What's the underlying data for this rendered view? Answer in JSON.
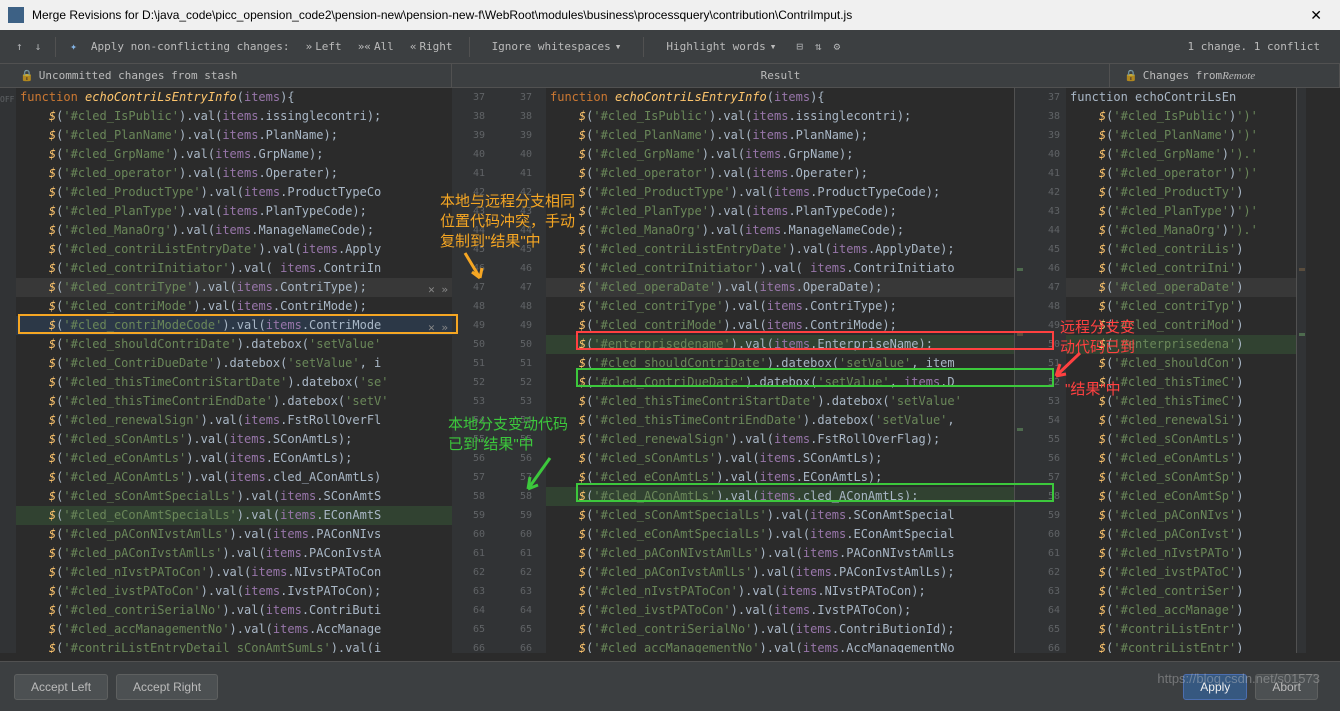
{
  "title": "Merge Revisions for D:\\java_code\\picc_opension_code2\\pension-new\\pension-new-f\\WebRoot\\modules\\business\\processquery\\contribution\\ContriImput.js",
  "toolbar": {
    "apply_label": "Apply non-conflicting changes:",
    "left_btn": "Left",
    "all_btn": "All",
    "right_btn": "Right",
    "ignore": "Ignore whitespaces",
    "highlight": "Highlight words",
    "status": "1 change. 1 conflict"
  },
  "headers": {
    "left": "Uncommitted changes from stash",
    "middle": "Result",
    "right_prefix": "Changes from ",
    "right_remote": "Remote"
  },
  "gutter_off": "OFF",
  "line_nums_left": [
    "37",
    "38",
    "39",
    "40",
    "41",
    "42",
    "43",
    "44",
    "45",
    "46",
    "47",
    "48",
    "49",
    "50",
    "51",
    "52",
    "53",
    "54",
    "55",
    "56",
    "57",
    "58",
    "",
    "59",
    "60",
    "61",
    "62",
    "63",
    "64",
    "65",
    "66"
  ],
  "line_nums_mid": [
    "37",
    "38",
    "39",
    "40",
    "41",
    "42",
    "43",
    "44",
    "45",
    "46",
    "47",
    "48",
    "49",
    "50",
    "51",
    "52",
    "53",
    "54",
    "55",
    "56",
    "57",
    "58",
    "59",
    "60",
    "61",
    "62",
    "63",
    "64",
    "65",
    "66"
  ],
  "left_code": [
    {
      "pre": "",
      "text": "function echoContriLsEntryInfo(items){",
      "cls": ""
    },
    {
      "pre": "    ",
      "sel": "#cled_IsPublic",
      "call": ".val(items.issinglecontri);"
    },
    {
      "pre": "    ",
      "sel": "#cled_PlanName",
      "call": ".val(items.PlanName);"
    },
    {
      "pre": "    ",
      "sel": "#cled_GrpName",
      "call": ".val(items.GrpName);"
    },
    {
      "pre": "    ",
      "sel": "#cled_operator",
      "call": ".val(items.Operater);"
    },
    {
      "pre": "    ",
      "sel": "#cled_ProductType",
      "call": ".val(items.ProductTypeCo"
    },
    {
      "pre": "    ",
      "sel": "#cled_PlanType",
      "call": ".val(items.PlanTypeCode);"
    },
    {
      "pre": "    ",
      "sel": "#cled_ManaOrg",
      "call": ".val(items.ManageNameCode);"
    },
    {
      "pre": "    ",
      "sel": "#cled_contriListEntryDate",
      "call": ".val(items.Apply"
    },
    {
      "pre": "    ",
      "sel": "#cled_contriInitiator",
      "call": ".val( items.ContriIn"
    },
    {
      "pre": "    ",
      "sel": "#cled_contriType",
      "call": ".val(items.ContriType);",
      "cls": "hl-gray",
      "marks": true
    },
    {
      "pre": "    ",
      "sel": "#cled_contriMode",
      "call": ".val(items.ContriMode);"
    },
    {
      "pre": "    ",
      "sel": "#cled_contriModeCode",
      "call": ".val(items.ContriMode",
      "cls": "hl-blue",
      "marks": true
    },
    {
      "pre": "    ",
      "sel": "#cled_shouldContriDate",
      "call": ".datebox('setValue'"
    },
    {
      "pre": "    ",
      "sel": "#cled_ContriDueDate",
      "call": ".datebox('setValue', i"
    },
    {
      "pre": "    ",
      "sel": "#cled_thisTimeContriStartDate",
      "call": ".datebox('se"
    },
    {
      "pre": "    ",
      "sel": "#cled_thisTimeContriEndDate",
      "call": ".datebox('setV"
    },
    {
      "pre": "    ",
      "sel": "#cled_renewalSign",
      "call": ".val(items.FstRollOverFl"
    },
    {
      "pre": "    ",
      "sel": "#cled_sConAmtLs",
      "call": ".val(items.SConAmtLs);"
    },
    {
      "pre": "    ",
      "sel": "#cled_eConAmtLs",
      "call": ".val(items.EConAmtLs);"
    },
    {
      "pre": "    ",
      "sel": "#cled_AConAmtLs",
      "call": ".val(items.cled_AConAmtLs)"
    },
    {
      "pre": "    ",
      "sel": "#cled_sConAmtSpecialLs",
      "call": ".val(items.SConAmtS"
    },
    {
      "pre": "    ",
      "sel": "#cled_eConAmtSpecialLs",
      "call": ".val(items.EConAmtS",
      "cls": "hl-green"
    },
    {
      "pre": "    ",
      "sel": "#cled_pAConNIvstAmlLs",
      "call": ".val(items.PAConNIvs"
    },
    {
      "pre": "    ",
      "sel": "#cled_pAConIvstAmlLs",
      "call": ".val(items.PAConIvstA"
    },
    {
      "pre": "    ",
      "sel": "#cled_nIvstPAToCon",
      "call": ".val(items.NIvstPAToCon"
    },
    {
      "pre": "    ",
      "sel": "#cled_ivstPAToCon",
      "call": ".val(items.IvstPAToCon);"
    },
    {
      "pre": "    ",
      "sel": "#cled_contriSerialNo",
      "call": ".val(items.ContriButi"
    },
    {
      "pre": "    ",
      "sel": "#cled_accManagementNo",
      "call": ".val(items.AccManage"
    },
    {
      "pre": "    ",
      "sel": "#contriListEntryDetail_sConAmtSumLs",
      "call": ".val(i"
    }
  ],
  "mid_code": [
    {
      "pre": "",
      "text": "function echoContriLsEntryInfo(items){"
    },
    {
      "pre": "    ",
      "sel": "#cled_IsPublic",
      "call": ".val(items.issinglecontri);"
    },
    {
      "pre": "    ",
      "sel": "#cled_PlanName",
      "call": ".val(items.PlanName);"
    },
    {
      "pre": "    ",
      "sel": "#cled_GrpName",
      "call": ".val(items.GrpName);"
    },
    {
      "pre": "    ",
      "sel": "#cled_operator",
      "call": ".val(items.Operater);"
    },
    {
      "pre": "    ",
      "sel": "#cled_ProductType",
      "call": ".val(items.ProductTypeCode);"
    },
    {
      "pre": "    ",
      "sel": "#cled_PlanType",
      "call": ".val(items.PlanTypeCode);"
    },
    {
      "pre": "    ",
      "sel": "#cled_ManaOrg",
      "call": ".val(items.ManageNameCode);"
    },
    {
      "pre": "    ",
      "sel": "#cled_contriListEntryDate",
      "call": ".val(items.ApplyDate);"
    },
    {
      "pre": "    ",
      "sel": "#cled_contriInitiator",
      "call": ".val( items.ContriInitiato"
    },
    {
      "pre": "    ",
      "sel": "#cled_operaDate",
      "call": ".val(items.OperaDate);",
      "cls": "hl-gray"
    },
    {
      "pre": "    ",
      "sel": "#cled_contriType",
      "call": ".val(items.ContriType);"
    },
    {
      "pre": "    ",
      "sel": "#cled_contriMode",
      "call": ".val(items.ContriMode);"
    },
    {
      "pre": "    ",
      "sel": "#enterprisedename",
      "call": ".val(items.EnterpriseName);",
      "cls": "hl-green"
    },
    {
      "pre": "    ",
      "sel": "#cled_shouldContriDate",
      "call": ".datebox('setValue', item"
    },
    {
      "pre": "    ",
      "sel": "#cled_ContriDueDate",
      "call": ".datebox('setValue', items.D"
    },
    {
      "pre": "    ",
      "sel": "#cled_thisTimeContriStartDate",
      "call": ".datebox('setValue"
    },
    {
      "pre": "    ",
      "sel": "#cled_thisTimeContriEndDate",
      "call": ".datebox('setValue',"
    },
    {
      "pre": "    ",
      "sel": "#cled_renewalSign",
      "call": ".val(items.FstRollOverFlag);"
    },
    {
      "pre": "    ",
      "sel": "#cled_sConAmtLs",
      "call": ".val(items.SConAmtLs);"
    },
    {
      "pre": "    ",
      "sel": "#cled_eConAmtLs",
      "call": ".val(items.EConAmtLs);"
    },
    {
      "pre": "    ",
      "sel": "#cled_AConAmtLs",
      "call": ".val(items.cled_AConAmtLs);",
      "cls": "hl-green"
    },
    {
      "pre": "    ",
      "sel": "#cled_sConAmtSpecialLs",
      "call": ".val(items.SConAmtSpecial"
    },
    {
      "pre": "    ",
      "sel": "#cled_eConAmtSpecialLs",
      "call": ".val(items.EConAmtSpecial"
    },
    {
      "pre": "    ",
      "sel": "#cled_pAConNIvstAmlLs",
      "call": ".val(items.PAConNIvstAmlLs"
    },
    {
      "pre": "    ",
      "sel": "#cled_pAConIvstAmlLs",
      "call": ".val(items.PAConIvstAmlLs);"
    },
    {
      "pre": "    ",
      "sel": "#cled_nIvstPAToCon",
      "call": ".val(items.NIvstPAToCon);"
    },
    {
      "pre": "    ",
      "sel": "#cled_ivstPAToCon",
      "call": ".val(items.IvstPAToCon);"
    },
    {
      "pre": "    ",
      "sel": "#cled_contriSerialNo",
      "call": ".val(items.ContriButionId);"
    },
    {
      "pre": "    ",
      "sel": "#cled_accManagementNo",
      "call": ".val(items.AccManagementNo"
    }
  ],
  "right_code": [
    {
      "pre": "",
      "text": "function echoContriLsEn"
    },
    {
      "pre": "    ",
      "sel": "#cled_IsPublic",
      "call": "')"
    },
    {
      "pre": "    ",
      "sel": "#cled_PlanName",
      "call": "')"
    },
    {
      "pre": "    ",
      "sel": "#cled_GrpName",
      "call": "')."
    },
    {
      "pre": "    ",
      "sel": "#cled_operator",
      "call": "')"
    },
    {
      "pre": "    ",
      "sel": "#cled_ProductTy",
      "call": ""
    },
    {
      "pre": "    ",
      "sel": "#cled_PlanType",
      "call": "')"
    },
    {
      "pre": "    ",
      "sel": "#cled_ManaOrg",
      "call": "')."
    },
    {
      "pre": "    ",
      "sel": "#cled_contriLis",
      "call": ""
    },
    {
      "pre": "    ",
      "sel": "#cled_contriIni",
      "call": ""
    },
    {
      "pre": "    ",
      "sel": "#cled_operaDate",
      "call": "",
      "cls": "hl-gray"
    },
    {
      "pre": "    ",
      "sel": "#cled_contriTyp",
      "call": ""
    },
    {
      "pre": "    ",
      "sel": "#cled_contriMod",
      "call": ""
    },
    {
      "pre": "    ",
      "sel": "#enterprisedena",
      "call": "",
      "cls": "hl-green"
    },
    {
      "pre": "    ",
      "sel": "#cled_shouldCon",
      "call": ""
    },
    {
      "pre": "    ",
      "sel": "#cled_thisTimeC",
      "call": ""
    },
    {
      "pre": "    ",
      "sel": "#cled_thisTimeC",
      "call": ""
    },
    {
      "pre": "    ",
      "sel": "#cled_renewalSi",
      "call": ""
    },
    {
      "pre": "    ",
      "sel": "#cled_sConAmtLs",
      "call": ""
    },
    {
      "pre": "    ",
      "sel": "#cled_eConAmtLs",
      "call": ""
    },
    {
      "pre": "    ",
      "sel": "#cled_sConAmtSp",
      "call": ""
    },
    {
      "pre": "    ",
      "sel": "#cled_eConAmtSp",
      "call": ""
    },
    {
      "pre": "    ",
      "sel": "#cled_pAConNIvs",
      "call": ""
    },
    {
      "pre": "    ",
      "sel": "#cled_pAConIvst",
      "call": ""
    },
    {
      "pre": "    ",
      "sel": "#cled_nIvstPATo",
      "call": ""
    },
    {
      "pre": "    ",
      "sel": "#cled_ivstPAToC",
      "call": ""
    },
    {
      "pre": "    ",
      "sel": "#cled_contriSer",
      "call": ""
    },
    {
      "pre": "    ",
      "sel": "#cled_accManage",
      "call": ""
    },
    {
      "pre": "    ",
      "sel": "#contriListEntr",
      "call": ""
    },
    {
      "pre": "    ",
      "sel": "#contriListEntr",
      "call": ""
    }
  ],
  "annotations": {
    "orange1": "本地与远程分支相同",
    "orange2": "位置代码冲突，手动",
    "orange3": "复制到\"结果\"中",
    "red1": "远程分支变",
    "red2": "动代码已到",
    "red3": "\"结果\"中",
    "green1": "本地分支变动代码",
    "green2": "已到\"结果\"中"
  },
  "footer": {
    "accept_left": "Accept Left",
    "accept_right": "Accept Right",
    "apply": "Apply",
    "abort": "Abort"
  },
  "watermark": "https://blog.csdn.net/s01573"
}
